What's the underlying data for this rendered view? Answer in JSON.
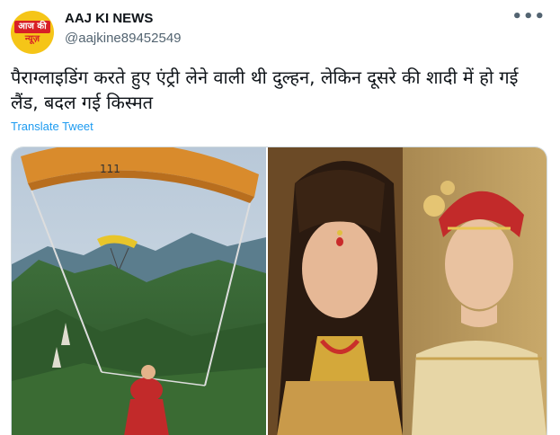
{
  "account": {
    "name": "AAJ KI NEWS",
    "handle": "@aajkine89452549",
    "avatar_logo_top": "आज की",
    "avatar_logo_bottom": "न्यूज़",
    "more_label": "•••"
  },
  "tweet": {
    "text": "पैराग्लाइडिंग करते हुए एंट्री लेने वाली थी दुल्हन, लेकिन दूसरे की शादी में हो गई लैंड, बदल गई किस्मत",
    "translate_label": "Translate Tweet"
  },
  "media": {
    "left_image": "paraglider-bride-over-mountains",
    "right_image": "bride-and-groom-wedding-photo"
  },
  "colors": {
    "link": "#1d9bf0",
    "text": "#0f1419",
    "secondary": "#536471",
    "avatar_bg": "#f5c518",
    "avatar_red": "#d81f26"
  }
}
